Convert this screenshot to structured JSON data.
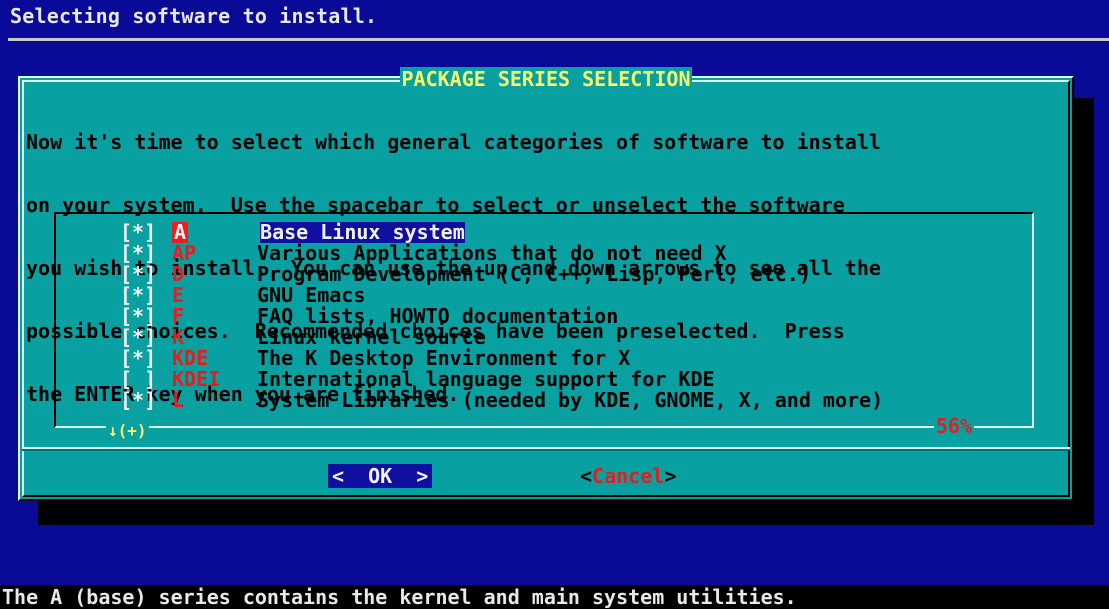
{
  "backtitle": "Selecting software to install.",
  "dialog": {
    "title": "PACKAGE SERIES SELECTION",
    "prompt_lines": [
      "Now it's time to select which general categories of software to install",
      "on your system.  Use the spacebar to select or unselect the software",
      "you wish to install.  You can use the up and down arrows to see all the",
      "possible choices.  Recommended choices have been preselected.  Press",
      "the ENTER key when you are finished."
    ],
    "items": [
      {
        "check": "[*]",
        "tag": "A",
        "desc": "Base Linux system",
        "selected": true
      },
      {
        "check": "[*]",
        "tag": "AP",
        "desc": "Various Applications that do not need X",
        "selected": false
      },
      {
        "check": "[*]",
        "tag": "D",
        "desc": "Program Development (C, C++, Lisp, Perl, etc.)",
        "selected": false
      },
      {
        "check": "[*]",
        "tag": "E",
        "desc": "GNU Emacs",
        "selected": false
      },
      {
        "check": "[*]",
        "tag": "F",
        "desc": "FAQ lists, HOWTO documentation",
        "selected": false
      },
      {
        "check": "[*]",
        "tag": "K",
        "desc": "Linux kernel source",
        "selected": false
      },
      {
        "check": "[*]",
        "tag": "KDE",
        "desc": "The K Desktop Environment for X",
        "selected": false
      },
      {
        "check": "[ ]",
        "tag": "KDEI",
        "desc": "International language support for KDE",
        "selected": false
      },
      {
        "check": "[*]",
        "tag": "L",
        "desc": "System Libraries (needed by KDE, GNOME, X, and more)",
        "selected": false
      }
    ],
    "scroll_hint": "↓(+)",
    "scroll_percent": "56%",
    "ok_button": {
      "left": "<  ",
      "hot": "O",
      "rest": "K",
      "right": "  >"
    },
    "cancel_button": {
      "left": "<",
      "hot": "C",
      "rest": "ancel",
      "right": ">"
    }
  },
  "statusbar": "The A (base) series contains the kernel and main system utilities.",
  "colors": {
    "background": "#0a0a98",
    "dialog": "#08a0a0",
    "title": "#f8f86a",
    "tag": "#e02020",
    "highlight": "#1010a0"
  }
}
